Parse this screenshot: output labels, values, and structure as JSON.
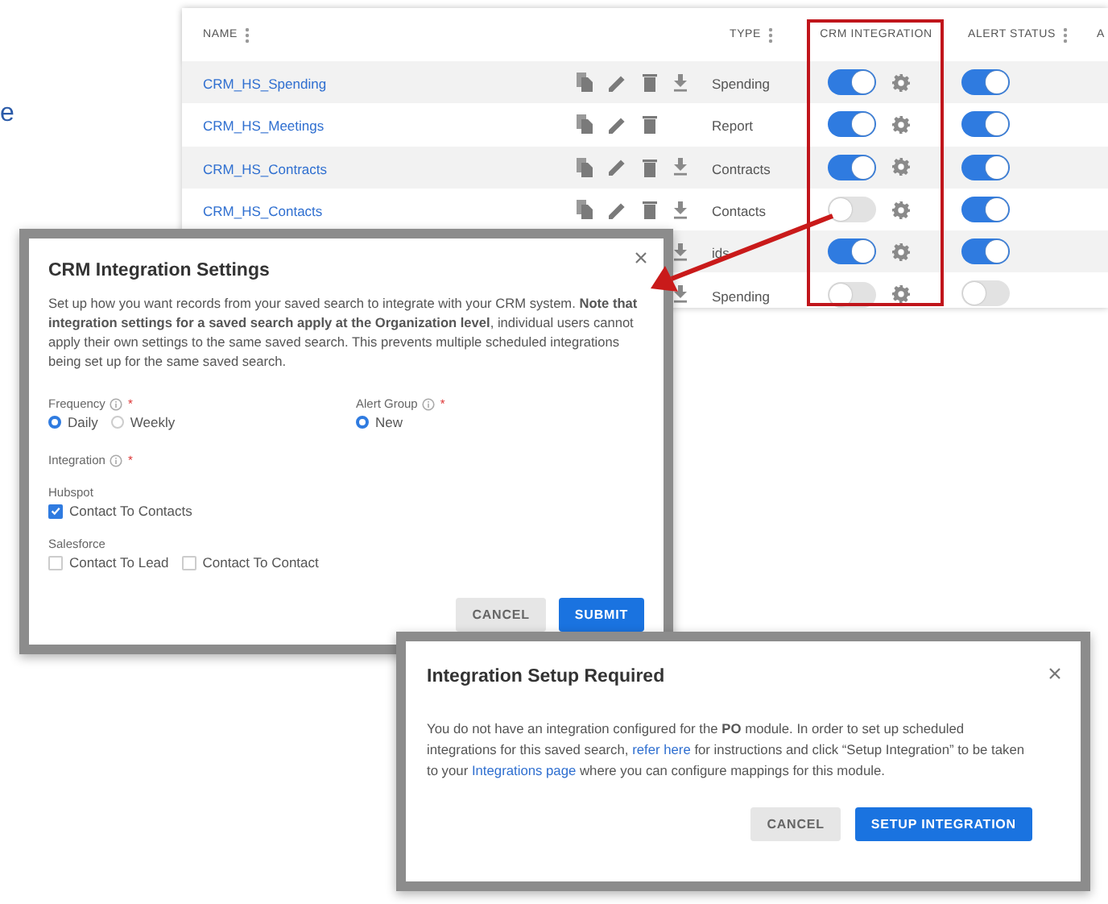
{
  "background_text": "e",
  "table": {
    "columns": [
      "NAME",
      "TYPE",
      "CRM INTEGRATION",
      "ALERT STATUS",
      "A"
    ],
    "rows": [
      {
        "name": "CRM_HS_Spending",
        "type": "Spending",
        "download": true,
        "crm_integration": true,
        "alert_status": true
      },
      {
        "name": "CRM_HS_Meetings",
        "type": "Report",
        "download": false,
        "crm_integration": true,
        "alert_status": true
      },
      {
        "name": "CRM_HS_Contracts",
        "type": "Contracts",
        "download": true,
        "crm_integration": true,
        "alert_status": true
      },
      {
        "name": "CRM_HS_Contacts",
        "type": "Contacts",
        "download": true,
        "crm_integration": false,
        "alert_status": true
      },
      {
        "type": "ids",
        "download": true,
        "crm_integration": true,
        "alert_status": true
      },
      {
        "type": "Spending",
        "download": true,
        "crm_integration": false,
        "alert_status": false
      }
    ]
  },
  "settings_dialog": {
    "title": "CRM Integration Settings",
    "description": "Set up how you want records from your saved search to integrate with your CRM system. **Note that integration settings for a saved search apply at the Organization level**, individual users cannot apply their own settings to the same saved search. This prevents multiple scheduled integrations being set up for the same saved search.",
    "frequency": {
      "label": "Frequency",
      "required_mark": "*",
      "options": [
        {
          "label": "Daily",
          "selected": true
        },
        {
          "label": "Weekly",
          "selected": false
        }
      ]
    },
    "alert_group": {
      "label": "Alert Group",
      "required_mark": "*",
      "options": [
        {
          "label": "New",
          "selected": true
        }
      ]
    },
    "integration": {
      "label": "Integration",
      "required_mark": "*"
    },
    "groups": [
      {
        "name": "Hubspot",
        "options": [
          {
            "label": "Contact To Contacts",
            "checked": true
          }
        ]
      },
      {
        "name": "Salesforce",
        "options": [
          {
            "label": "Contact To Lead",
            "checked": false
          },
          {
            "label": "Contact To Contact",
            "checked": false
          }
        ]
      }
    ],
    "buttons": [
      {
        "label": "CANCEL",
        "kind": "secondary"
      },
      {
        "label": "SUBMIT",
        "kind": "primary"
      }
    ]
  },
  "setup_dialog": {
    "title": "Integration Setup Required",
    "message": [
      {
        "kind": "text",
        "text": "You do not have an integration configured for the **PO** module. In order to set up scheduled integrations for this saved search, "
      },
      {
        "kind": "link",
        "text": "refer here"
      },
      {
        "kind": "text",
        "text": " for instructions and click “Setup Integration” to be taken to your "
      },
      {
        "kind": "link",
        "text": "Integrations page"
      },
      {
        "kind": "text",
        "text": " where you can configure mappings for this module."
      }
    ],
    "buttons": [
      {
        "label": "CANCEL",
        "kind": "secondary"
      },
      {
        "label": "SETUP INTEGRATION",
        "kind": "primary"
      }
    ]
  }
}
